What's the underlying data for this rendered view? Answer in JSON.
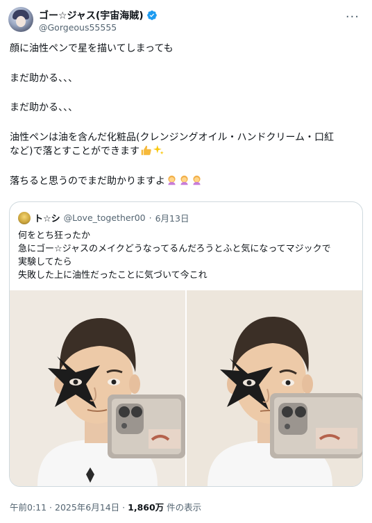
{
  "author": {
    "name": "ゴー☆ジャス(宇宙海賊)",
    "handle": "@Gorgeous55555",
    "verified": true,
    "more_icon": "more-dots-icon"
  },
  "tweet": {
    "lines": [
      "顔に油性ペンで星を描いてしまっても",
      "まだ助かる、、、",
      "まだ助かる、、、",
      "油性ペンは油を含んだ化粧品(クレンジングオイル・ハンドクリーム・口紅",
      "など)で落とすことができます",
      "落ちると思うのでまだ助かりますよ"
    ],
    "emoji": [
      "thumbs-up-icon",
      "sparkles-icon",
      "person-bowing-icon"
    ]
  },
  "quote": {
    "name": "ト☆シ",
    "handle": "@Love_together00",
    "separator": "·",
    "date": "6月13日",
    "lines": [
      "何をとち狂ったか",
      "急にゴー☆ジャスのメイクどうなってるんだろうとふと気になってマジックで",
      "実験してたら",
      "失敗した上に油性だったことに気づいて今これ"
    ],
    "images": [
      "selfie-photo-left",
      "selfie-photo-right"
    ]
  },
  "footer": {
    "timestamp": "午前0:11 · 2025年6月14日",
    "separator": "·",
    "views_count": "1,860万",
    "views_label": "件の表示"
  },
  "colors": {
    "text": "#0f1419",
    "secondary": "#536471",
    "verified": "#1d9bf0",
    "border": "#cfd9de"
  }
}
